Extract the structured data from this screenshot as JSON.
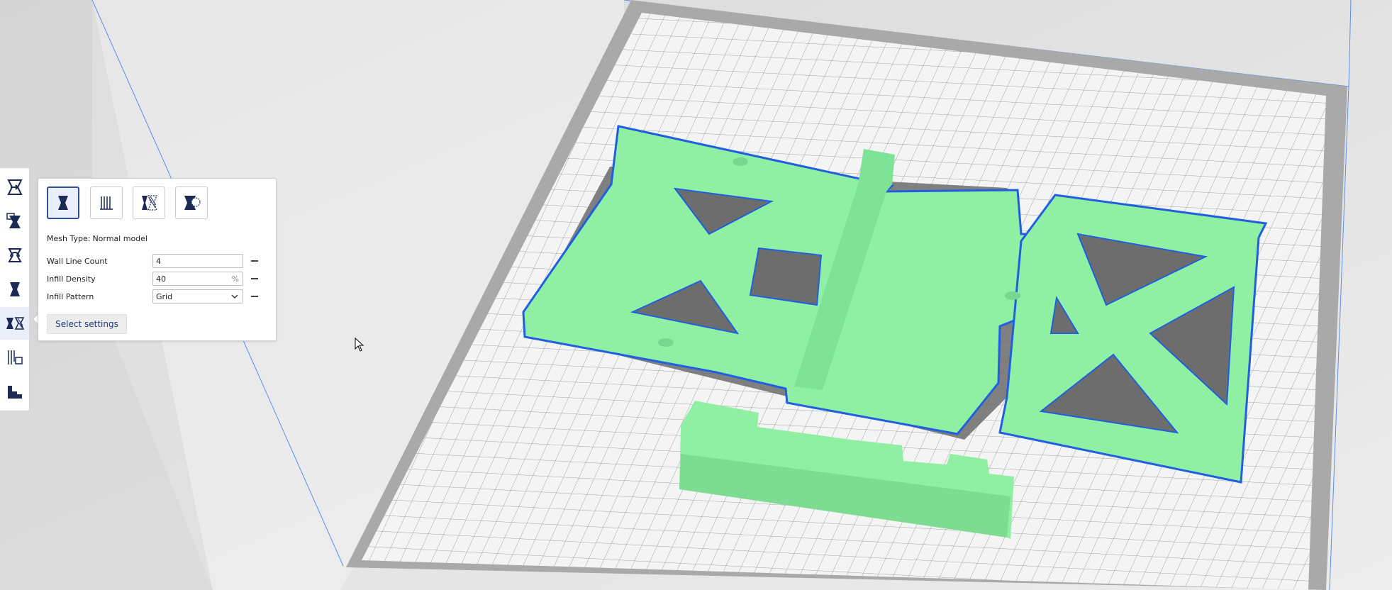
{
  "window": {
    "title": ""
  },
  "toolbar": {
    "tools": [
      {
        "name": "move-tool",
        "icon": "move-icon",
        "active": false
      },
      {
        "name": "scale-tool",
        "icon": "scale-icon",
        "active": false
      },
      {
        "name": "rotate-tool",
        "icon": "rotate-icon",
        "active": false
      },
      {
        "name": "mirror-tool",
        "icon": "mirror-icon",
        "active": false
      },
      {
        "name": "per-model-settings-tool",
        "icon": "per-model-settings-icon",
        "active": true
      },
      {
        "name": "support-blocker-tool",
        "icon": "support-blocker-icon",
        "active": false
      },
      {
        "name": "layer-view-tool",
        "icon": "layer-icon",
        "active": false
      }
    ]
  },
  "panel": {
    "mesh_types": [
      {
        "name": "normal-model",
        "icon": "normal-model-icon",
        "active": true
      },
      {
        "name": "print-as-support",
        "icon": "support-mesh-icon",
        "active": false
      },
      {
        "name": "modify-settings-overlaps",
        "icon": "overlap-mesh-icon",
        "active": false
      },
      {
        "name": "dont-support-overlaps",
        "icon": "anti-overhang-icon",
        "active": false
      }
    ],
    "mesh_type_label": "Mesh Type:",
    "mesh_type_value": "Normal model",
    "settings": [
      {
        "label": "Wall Line Count",
        "value": "4",
        "unit": ""
      },
      {
        "label": "Infill Density",
        "value": "40",
        "unit": "%"
      },
      {
        "label": "Infill Pattern",
        "value": "Grid",
        "unit": ""
      }
    ],
    "select_settings_label": "Select settings"
  },
  "colors": {
    "model": "#8ff0a4",
    "outline": "#1f5fe0",
    "build_plate": "#f4f4f4",
    "accent": "#1f3c82"
  }
}
